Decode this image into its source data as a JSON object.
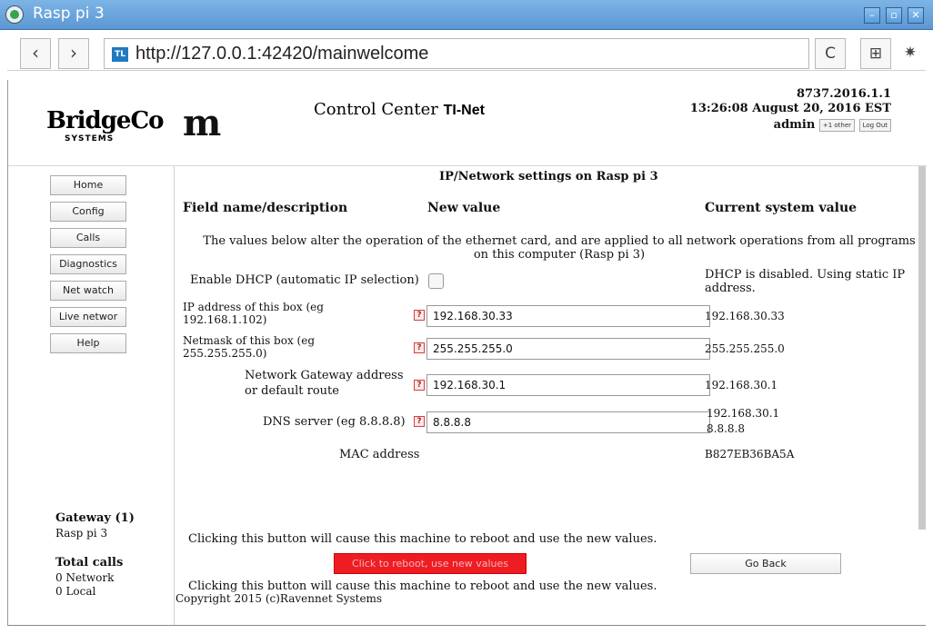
{
  "window": {
    "title": "Rasp pi 3"
  },
  "browser": {
    "back": "‹",
    "forward": "›",
    "favicon": "TL",
    "url": "http://127.0.0.1:42420/mainwelcome",
    "reload": "C",
    "bookmark": "⊞",
    "settings": "✷"
  },
  "header": {
    "logo_text": "BridgeCo",
    "logo_m": "m",
    "logo_sub": "SYSTEMS",
    "title": "Control Center",
    "title_sub": "TI-Net",
    "version": "8737.2016.1.1",
    "datetime": "13:26:08 August 20, 2016 EST",
    "user": "admin",
    "other_btn": "+1 other",
    "logout_btn": "Log Out"
  },
  "sidebar": {
    "items": [
      {
        "label": "Home"
      },
      {
        "label": "Config"
      },
      {
        "label": "Calls"
      },
      {
        "label": "Diagnostics"
      },
      {
        "label": "Net watch"
      },
      {
        "label": "Live networ"
      },
      {
        "label": "Help"
      }
    ],
    "gateway_title": "Gateway (1)",
    "gateway_name": "Rasp pi 3",
    "calls_title": "Total calls",
    "calls_network": "0 Network",
    "calls_local": "0 Local"
  },
  "main": {
    "heading": "IP/Network settings on Rasp pi 3",
    "col_field": "Field name/description",
    "col_new": "New value",
    "col_current": "Current system value",
    "intro_line1": "The values below alter the operation of the ethernet card, and are applied to all network operations from all programs",
    "intro_line2": "on this computer (Rasp pi 3)",
    "dhcp_label": "Enable DHCP (automatic IP selection)",
    "dhcp_current_1": "DHCP is disabled. Using static IP",
    "dhcp_current_2": "address.",
    "ip_label_1": "IP address of this box (eg",
    "ip_label_2": "192.168.1.102)",
    "ip_value": "192.168.30.33",
    "ip_current": "192.168.30.33",
    "mask_label_1": "Netmask of this box (eg",
    "mask_label_2": "255.255.255.0)",
    "mask_value": "255.255.255.0",
    "mask_current": "255.255.255.0",
    "gw_label_1": "Network Gateway address",
    "gw_label_2": "or default route",
    "gw_value": "192.168.30.1",
    "gw_current": "192.168.30.1",
    "dns_label": "DNS server (eg 8.8.8.8)",
    "dns_value": "8.8.8.8",
    "dns_current_1": "192.168.30.1",
    "dns_current_2": "8.8.8.8",
    "mac_label": "MAC address",
    "mac_current": "B827EB36BA5A",
    "help_mark": "?",
    "note": "Clicking this button will cause this machine to reboot and use the new values.",
    "reboot_btn": "Click to reboot, use new values",
    "back_btn": "Go Back",
    "note2": "Clicking this button will cause this machine to reboot and use the new values.",
    "copyright": "Copyright 2015 (c)Ravennet Systems"
  }
}
